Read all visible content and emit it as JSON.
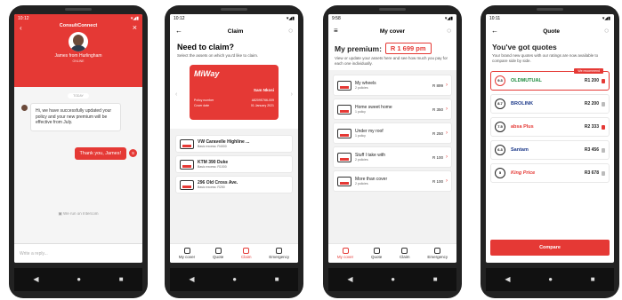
{
  "phones": [
    {
      "time": "10:12",
      "title": "ConsultConnect",
      "agent_name": "James from Hurlingham",
      "agent_status": "ONLINE",
      "today": "TODAY",
      "message_in": "Hi, we have successfully updated your policy and your new premium will be effective from July.",
      "message_out": "Thank you, James!",
      "reply_count": "S",
      "intercom": "We run on Intercom",
      "reply_placeholder": "Write a reply..."
    },
    {
      "time": "10:12",
      "title": "Claim",
      "heading": "Need to claim?",
      "subtitle": "Select the assets on which you'd like to claim.",
      "card": {
        "logo": "MiWay",
        "name": "Sam Nkosi",
        "policy_label": "Policy number",
        "policy_value": "A8209S766-009",
        "date_label": "Cover date",
        "date_value": "01 January 2021"
      },
      "assets": [
        {
          "title": "VW Caravelle Highline ...",
          "sub": "Basic excess: R4000"
        },
        {
          "title": "KTM 390 Duke",
          "sub": "Basic excess: R1000"
        },
        {
          "title": "296 Old Cross Ave.",
          "sub": "Basic excess: R250"
        }
      ]
    },
    {
      "time": "9:58",
      "title": "My cover",
      "premium_label": "My premium:",
      "premium_value": "R 1 699 pm",
      "subtitle": "View or update your assets here and see how much you pay for each one individually.",
      "covers": [
        {
          "title": "My wheels",
          "sub": "2 policies",
          "price": "R 899"
        },
        {
          "title": "Home sweet home",
          "sub": "1 policy",
          "price": "R 350"
        },
        {
          "title": "Under my roof",
          "sub": "1 policy",
          "price": "R 250"
        },
        {
          "title": "Stuff I take with",
          "sub": "2 policies",
          "price": "R 100"
        },
        {
          "title": "More than cover",
          "sub": "2 policies",
          "price": "R 100"
        }
      ]
    },
    {
      "time": "10:11",
      "title": "Quote",
      "heading": "You've got quotes",
      "subtitle": "Your brand new quotes with our ratings are now available to compare side by side.",
      "recommend": "We recommend",
      "quotes": [
        {
          "rating": "9.3",
          "brand": "OLDMUTUAL",
          "price": "R1 200"
        },
        {
          "rating": "8.7",
          "brand": "BROLINK",
          "price": "R2 200"
        },
        {
          "rating": "7.5",
          "brand": "absa Plus",
          "price": "R2 333"
        },
        {
          "rating": "6.3",
          "brand": "Santam",
          "price": "R3 456"
        },
        {
          "rating": "5",
          "brand": "King Price",
          "price": "R3 678"
        }
      ],
      "compare": "Compare"
    }
  ],
  "tabs": [
    "My cover",
    "Quote",
    "Claim",
    "Emergency"
  ],
  "colors": {
    "accent": "#e53935"
  }
}
